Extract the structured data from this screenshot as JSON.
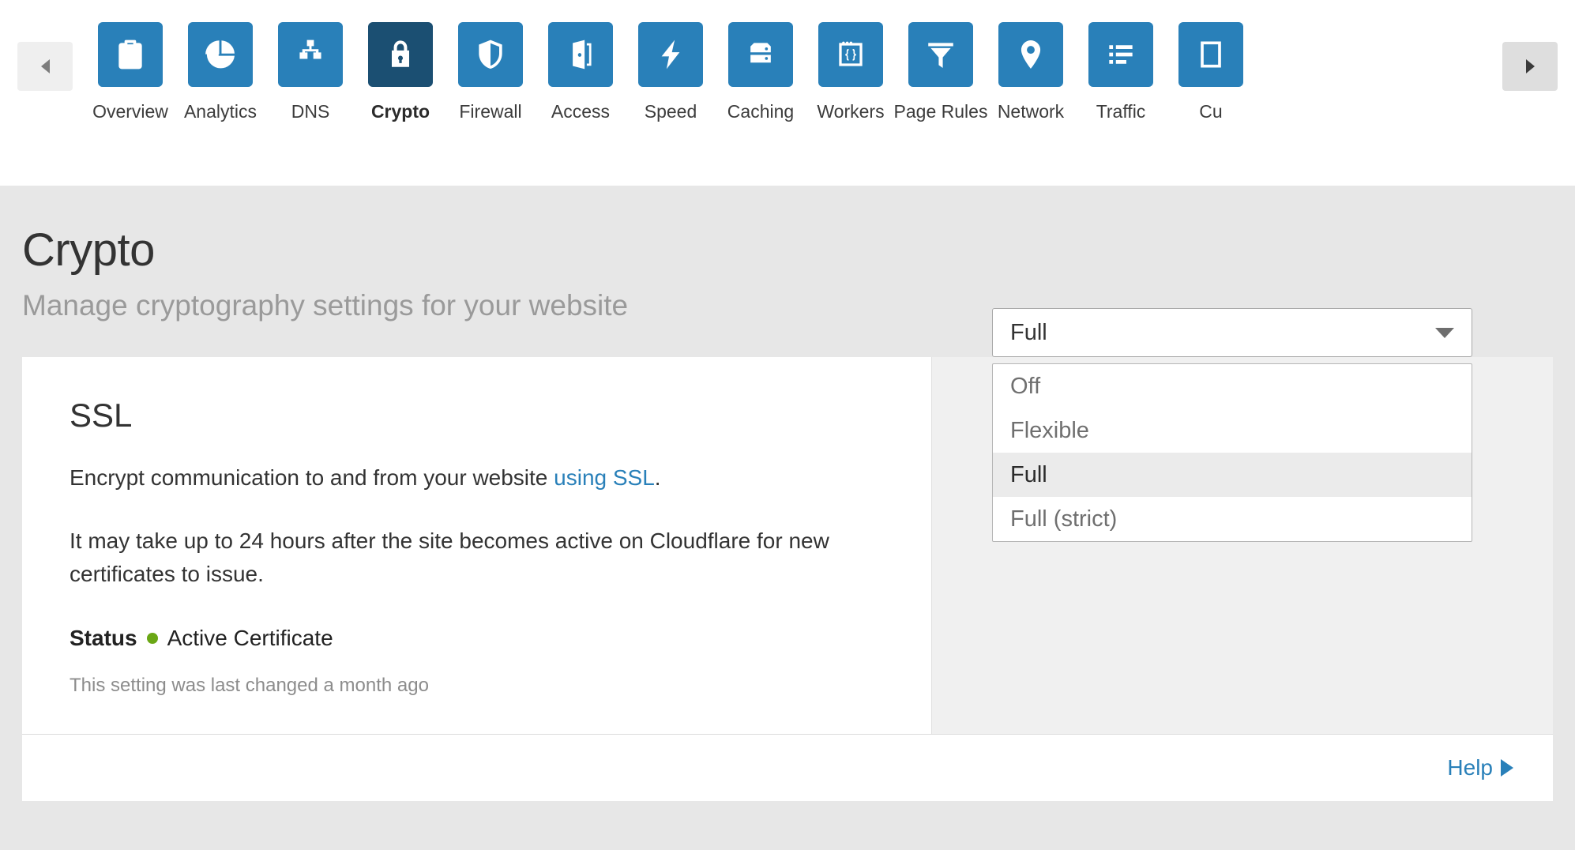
{
  "nav": {
    "scroll_left_label": "◀",
    "scroll_right_label": "▶",
    "items": [
      {
        "label": "Overview",
        "icon": "clipboard-icon",
        "active": false
      },
      {
        "label": "Analytics",
        "icon": "pie-chart-icon",
        "active": false
      },
      {
        "label": "DNS",
        "icon": "sitemap-icon",
        "active": false
      },
      {
        "label": "Crypto",
        "icon": "lock-icon",
        "active": true
      },
      {
        "label": "Firewall",
        "icon": "shield-icon",
        "active": false
      },
      {
        "label": "Access",
        "icon": "open-door-icon",
        "active": false
      },
      {
        "label": "Speed",
        "icon": "lightning-icon",
        "active": false
      },
      {
        "label": "Caching",
        "icon": "server-icon",
        "active": false
      },
      {
        "label": "Workers",
        "icon": "code-braces-icon",
        "active": false
      },
      {
        "label": "Page Rules",
        "icon": "funnel-icon",
        "active": false
      },
      {
        "label": "Network",
        "icon": "map-pin-icon",
        "active": false
      },
      {
        "label": "Traffic",
        "icon": "list-icon",
        "active": false
      },
      {
        "label": "Cu",
        "icon": "custom-pages-icon",
        "active": false
      }
    ]
  },
  "page": {
    "title": "Crypto",
    "subtitle": "Manage cryptography settings for your website"
  },
  "ssl_card": {
    "heading": "SSL",
    "description_prefix": "Encrypt communication to and from your website ",
    "description_link": "using SSL",
    "description_suffix": ".",
    "note": "It may take up to 24 hours after the site becomes active on Cloudflare for new certificates to issue.",
    "status_label": "Status",
    "status_value": "Active Certificate",
    "status_dot_color": "#6aa715",
    "last_changed": "This setting was last changed a month ago"
  },
  "ssl_select": {
    "value": "Full",
    "expanded": true,
    "options": [
      {
        "label": "Off",
        "selected": false
      },
      {
        "label": "Flexible",
        "selected": false
      },
      {
        "label": "Full",
        "selected": true
      },
      {
        "label": "Full (strict)",
        "selected": false
      }
    ]
  },
  "footer": {
    "help_label": "Help"
  },
  "colors": {
    "brand_blue": "#2980b9",
    "active_tile": "#1b4f72",
    "link_blue": "#2980b9",
    "status_green": "#6aa715",
    "page_bg": "#e7e7e7",
    "side_panel_bg": "#f0f0f0"
  }
}
